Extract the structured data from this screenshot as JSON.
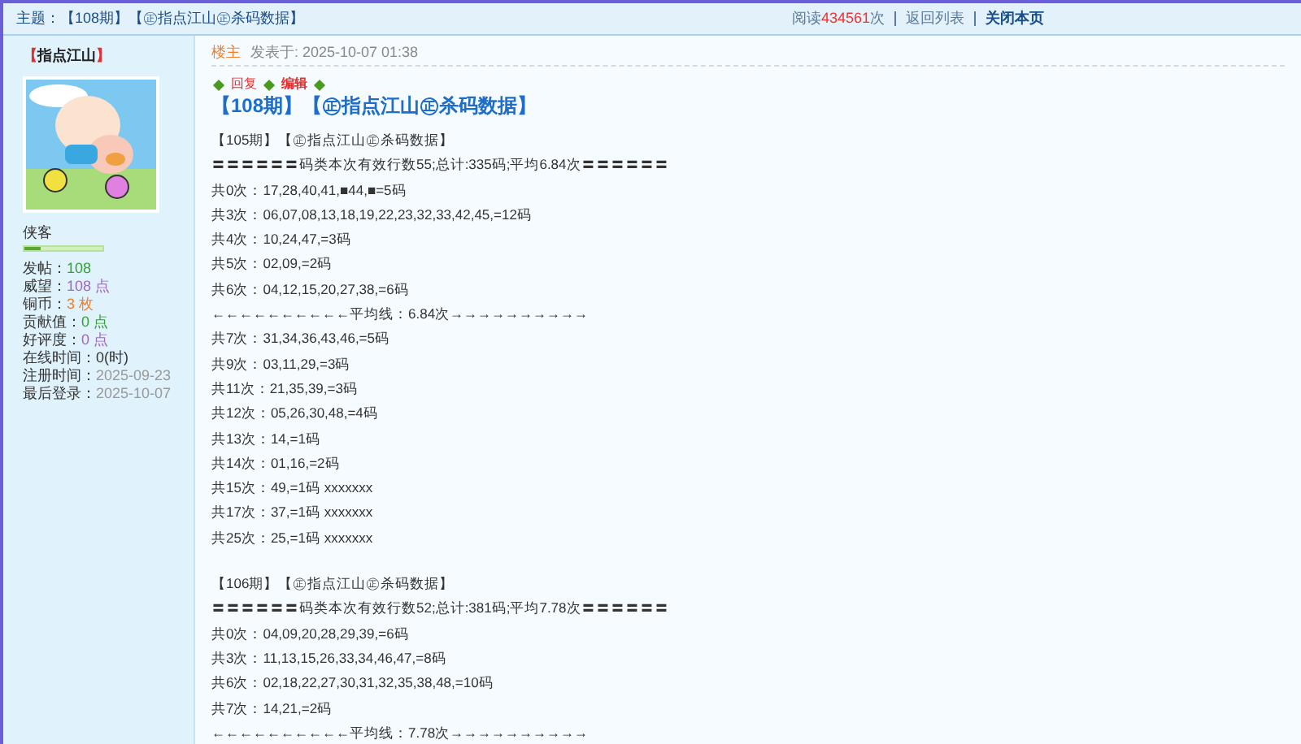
{
  "header": {
    "title_label": "主题：",
    "title": "【108期】【㊣指点江山㊣杀码数据】",
    "read_prefix": "阅读",
    "read_count": "434561",
    "read_suffix": "次",
    "links": [
      {
        "label": "返回列表",
        "emphasized": false
      },
      {
        "label": "关闭本页",
        "emphasized": true
      }
    ]
  },
  "sidebar": {
    "bracket_open": "【",
    "username": "指点江山",
    "bracket_close": "】",
    "rank": "侠客",
    "rank_bar": {
      "level": 0.2
    },
    "stats": [
      {
        "label": "发帖：",
        "value": "108",
        "color": "#33a033"
      },
      {
        "label": "威望：",
        "value": "108 点",
        "color": "#a066c0"
      },
      {
        "label": "铜币：",
        "value": "3 枚",
        "color": "#f08030"
      },
      {
        "label": "贡献值：",
        "value": "0 点",
        "color": "#33a033"
      },
      {
        "label": "好评度：",
        "value": "0 点",
        "color": "#a066c0"
      },
      {
        "label": "在线时间：",
        "value": "0(时)",
        "color": "#333333"
      },
      {
        "label": "注册时间：",
        "value": "2025-09-23",
        "color": "#999999"
      },
      {
        "label": "最后登录：",
        "value": "2025-10-07",
        "color": "#999999"
      }
    ]
  },
  "post": {
    "floor": "楼主",
    "posted": "发表于: 2025-10-07 01:38",
    "actions": [
      "回复",
      "编辑"
    ],
    "title": "【108期】【㊣指点江山㊣杀码数据】",
    "blocks": [
      {
        "lines": [
          "【105期】【㊣指点江山㊣杀码数据】",
          "〓〓〓〓〓〓码类本次有效行数55;总计:335码;平均6.84次〓〓〓〓〓〓",
          "共0次：17,28,40,41,■44,■=5码",
          "共3次：06,07,08,13,18,19,22,23,32,33,42,45,=12码",
          "共4次：10,24,47,=3码",
          "共5次：02,09,=2码",
          "共6次：04,12,15,20,27,38,=6码",
          "←←←←←←←←←←平均线：6.84次→→→→→→→→→→",
          "共7次：31,34,36,43,46,=5码",
          "共9次：03,11,29,=3码",
          "共11次：21,35,39,=3码",
          "共12次：05,26,30,48,=4码",
          "共13次：14,=1码",
          "共14次：01,16,=2码",
          "共15次：49,=1码 xxxxxxx",
          "共17次：37,=1码 xxxxxxx",
          "共25次：25,=1码 xxxxxxx"
        ]
      },
      {
        "lines": [
          "【106期】【㊣指点江山㊣杀码数据】",
          "〓〓〓〓〓〓码类本次有效行数52;总计:381码;平均7.78次〓〓〓〓〓〓",
          "共0次：04,09,20,28,29,39,=6码",
          "共3次：11,13,15,26,33,34,46,47,=8码",
          "共6次：02,18,22,27,30,31,32,35,38,48,=10码",
          "共7次：14,21,=2码",
          "←←←←←←←←←←平均线：7.78次→→→→→→→→→→"
        ]
      }
    ]
  }
}
